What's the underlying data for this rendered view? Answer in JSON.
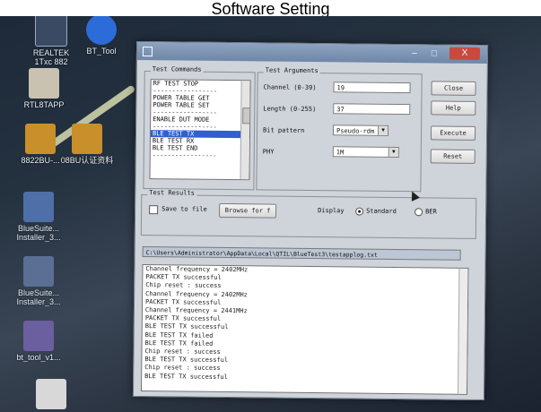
{
  "caption": "Software Setting",
  "desktop_icons": [
    {
      "label": "REALTEK",
      "sublabel": "1Txc 882",
      "icon": "realtek-icon"
    },
    {
      "label": "BT_Tool",
      "icon": "bt-tool-icon"
    },
    {
      "label": "RTL8TAPP",
      "icon": "rtl8tapp-icon"
    },
    {
      "label": "8822BU-...",
      "icon": "folder-icon"
    },
    {
      "label": "08BU认证资料",
      "icon": "folder-icon"
    },
    {
      "label": "BlueSuite...",
      "sublabel": "Installer_3...",
      "icon": "installer-icon"
    },
    {
      "label": "BlueSuite...",
      "sublabel": "Installer_3...",
      "icon": "installer-icon"
    },
    {
      "label": "bt_tool_v1...",
      "icon": "archive-icon"
    }
  ],
  "window": {
    "title": "",
    "close_label": "X"
  },
  "test_commands": {
    "title": "Test Commands",
    "items": [
      {
        "label": "RF TEST STOP",
        "selected": false
      },
      {
        "label": "-----------------",
        "selected": false
      },
      {
        "label": "POWER TABLE GET",
        "selected": false
      },
      {
        "label": "POWER TABLE SET",
        "selected": false
      },
      {
        "label": "-----------------",
        "selected": false
      },
      {
        "label": "ENABLE DUT MODE",
        "selected": false
      },
      {
        "label": "-----------------",
        "selected": false
      },
      {
        "label": "BLE TEST TX",
        "selected": true
      },
      {
        "label": "BLE TEST RX",
        "selected": false
      },
      {
        "label": "BLE TEST END",
        "selected": false
      },
      {
        "label": "-----------------",
        "selected": false
      }
    ]
  },
  "test_arguments": {
    "title": "Test Arguments",
    "channel_label": "Channel (0-39)",
    "channel_value": "19",
    "length_label": "Length (0-255)",
    "length_value": "37",
    "bit_pattern_label": "Bit pattern",
    "bit_pattern_value": "Pseudo-rdm",
    "phy_label": "PHY",
    "phy_value": "1M"
  },
  "buttons": {
    "close": "Close",
    "help": "Help",
    "execute": "Execute",
    "reset": "Reset"
  },
  "test_results": {
    "title": "Test Results",
    "save_to_file_label": "Save to file",
    "browse_label": "Browse for f",
    "display_label": "Display",
    "standard_label": "Standard",
    "ber_label": "BER",
    "path": "C:\\Users\\Administrator\\AppData\\Local\\QTIL\\BlueTest3\\testapplog.txt"
  },
  "log_lines": [
    "Channel frequency = 2402MHz",
    "PACKET TX successful",
    "Chip reset : success",
    "Channel frequency = 2402MHz",
    "PACKET TX successful",
    "Channel frequency = 2441MHz",
    "PACKET TX successful",
    "BLE TEST TX successful",
    "BLE TEST TX failed",
    "BLE TEST TX failed",
    "Chip reset : success",
    "BLE TEST TX successful",
    "Chip reset : success",
    "BLE TEST TX successful"
  ]
}
